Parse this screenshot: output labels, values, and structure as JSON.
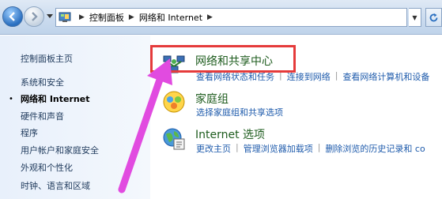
{
  "address_bar": {
    "crumbs": [
      "控制面板",
      "网络和 Internet"
    ],
    "icon": "control-panel-icon"
  },
  "sidebar": {
    "items": [
      {
        "label": "控制面板主页",
        "active": false
      },
      {
        "label": "系统和安全",
        "active": false
      },
      {
        "label": "网络和 Internet",
        "active": true
      },
      {
        "label": "硬件和声音",
        "active": false
      },
      {
        "label": "程序",
        "active": false
      },
      {
        "label": "用户帐户和家庭安全",
        "active": false
      },
      {
        "label": "外观和个性化",
        "active": false
      },
      {
        "label": "时钟、语言和区域",
        "active": false
      }
    ]
  },
  "main": {
    "categories": [
      {
        "title": "网络和共享中心",
        "icon": "network-sharing-icon",
        "links": [
          "查看网络状态和任务",
          "连接到网络",
          "查看网络计算机和设备"
        ]
      },
      {
        "title": "家庭组",
        "icon": "homegroup-icon",
        "links": [
          "选择家庭组和共享选项"
        ]
      },
      {
        "title": "Internet 选项",
        "icon": "internet-options-icon",
        "links": [
          "更改主页",
          "管理浏览器加载项",
          "删除浏览的历史记录和 co"
        ]
      }
    ]
  },
  "colors": {
    "highlight": "#e53b3b",
    "annotation_arrow": "#e14be0",
    "link": "#1d5aab",
    "category_title": "#1e5c1e"
  }
}
